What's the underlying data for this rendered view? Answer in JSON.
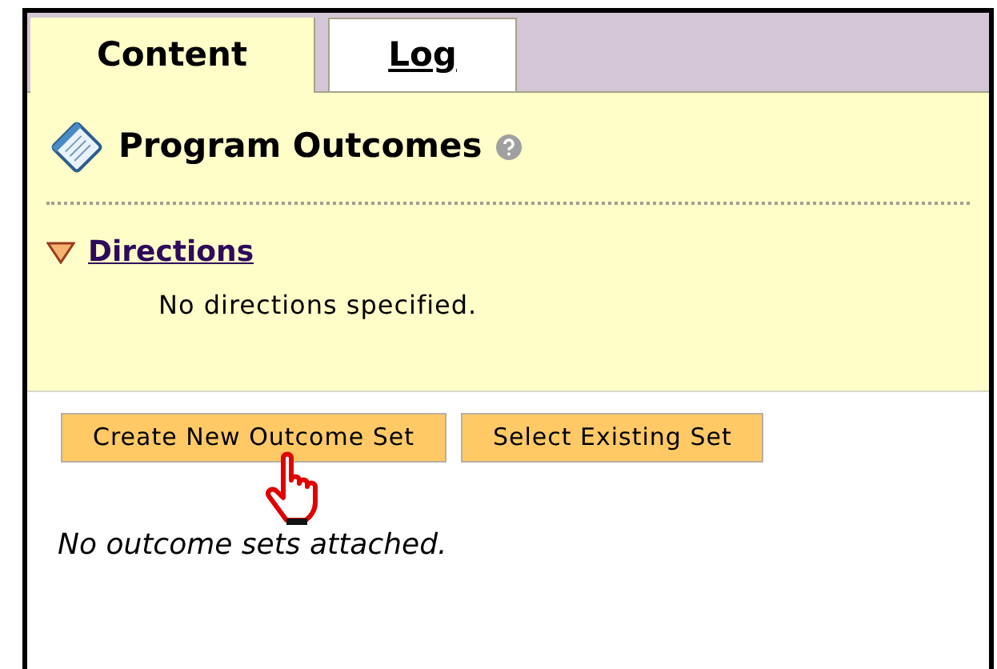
{
  "tabs": [
    {
      "label": "Content",
      "selected": true
    },
    {
      "label": "Log",
      "selected": false
    }
  ],
  "header": {
    "title": "Program Outcomes"
  },
  "directions": {
    "label": "Directions",
    "expanded": true,
    "text": "No directions specified."
  },
  "buttons": [
    "Create New Outcome Set",
    "Select Existing Set"
  ],
  "empty_message": "No outcome sets attached."
}
